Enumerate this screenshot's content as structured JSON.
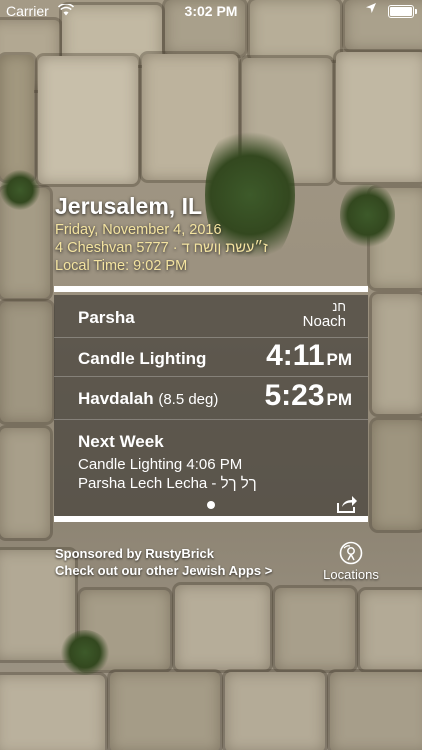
{
  "status_bar": {
    "carrier": "Carrier",
    "time": "3:02 PM"
  },
  "header": {
    "city": "Jerusalem, IL",
    "date": "Friday, November 4, 2016",
    "hebrew_date": "4 Cheshvan 5777 · ז״עשת ןושח ד",
    "local_time": "Local Time: 9:02 PM"
  },
  "rows": {
    "parsha": {
      "label": "Parsha",
      "hebrew": "חנ",
      "english": "Noach"
    },
    "candle": {
      "label": "Candle Lighting",
      "time": "4:11",
      "ampm": "PM"
    },
    "havdalah": {
      "label": "Havdalah",
      "note": "(8.5 deg)",
      "time": "5:23",
      "ampm": "PM"
    }
  },
  "next_week": {
    "title": "Next Week",
    "candle": "Candle Lighting 4:06 PM",
    "parsha": "Parsha Lech Lecha - ךל ךל"
  },
  "footer": {
    "sponsor": "Sponsored by RustyBrick",
    "apps_link": "Check out our other Jewish Apps >",
    "locations": "Locations"
  }
}
